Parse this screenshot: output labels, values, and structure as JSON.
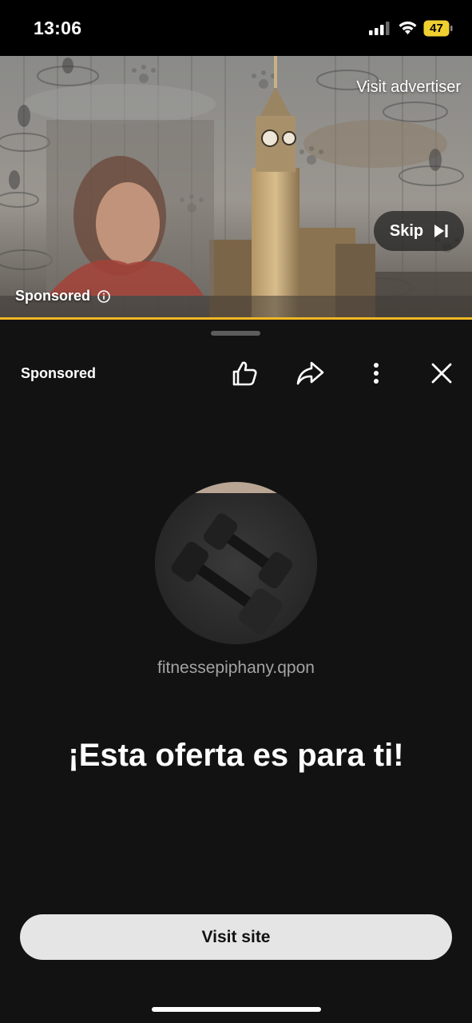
{
  "status_bar": {
    "time": "13:06",
    "battery": "47",
    "icons": [
      "signal-icon",
      "wifi-icon",
      "battery-icon"
    ],
    "battery_color": "#f0d030"
  },
  "video": {
    "visit_advertiser": "Visit advertiser",
    "skip_label": "Skip",
    "sponsored_label": "Sponsored",
    "progress_fraction": 1.0,
    "progress_color": "#f2b824"
  },
  "sheet": {
    "sponsored_label": "Sponsored",
    "actions": [
      "thumbs-up-icon",
      "share-icon",
      "more-vert-icon",
      "close-icon"
    ],
    "domain": "fitnessepiphany.qpon",
    "headline": "¡Esta oferta es para ti!",
    "cta_label": "Visit site"
  }
}
